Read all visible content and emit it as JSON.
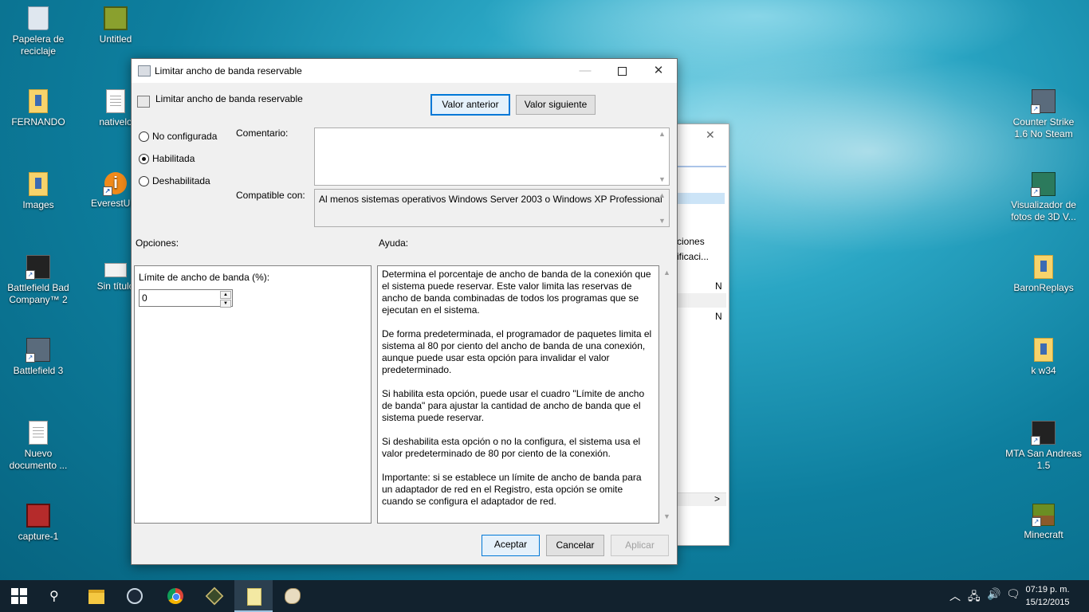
{
  "desktop": {
    "icons_left": [
      {
        "label": "Papelera de reciclaje",
        "icon": "recycle-bin-icon"
      },
      {
        "label": "Untitled",
        "icon": "video-file-icon"
      },
      {
        "label": "FERNANDO",
        "icon": "folder-icon"
      },
      {
        "label": "nativelo",
        "icon": "text-file-icon"
      },
      {
        "label": "Images",
        "icon": "folder-icon"
      },
      {
        "label": "EverestUltir",
        "icon": "everest-app-icon"
      },
      {
        "label": "Battlefield Bad Company™ 2",
        "icon": "game-icon"
      },
      {
        "label": "Sin título",
        "icon": "drive-icon"
      },
      {
        "label": "Battlefield 3",
        "icon": "game-icon"
      },
      {
        "label": "Nuevo documento ...",
        "icon": "text-file-icon"
      },
      {
        "label": "capture-1",
        "icon": "video-file-icon"
      }
    ],
    "icons_right": [
      {
        "label": "Counter Strike 1.6 No Steam",
        "icon": "counter-strike-icon"
      },
      {
        "label": "Visualizador de fotos de 3D V...",
        "icon": "photo-viewer-icon"
      },
      {
        "label": "BaronReplays",
        "icon": "folder-icon"
      },
      {
        "label": "k w34",
        "icon": "folder-icon"
      },
      {
        "label": "MTA San Andreas 1.5",
        "icon": "game-icon"
      },
      {
        "label": "Minecraft",
        "icon": "minecraft-icon"
      }
    ]
  },
  "background_window": {
    "partial_text_1": "ciones",
    "partial_text_2": "ificaci...",
    "partial_text_3": "N",
    "partial_text_4": "N",
    "scroll_right": ">"
  },
  "dialog": {
    "title": "Limitar ancho de banda reservable",
    "header_title": "Limitar ancho de banda reservable",
    "prev_button": "Valor anterior",
    "next_button": "Valor siguiente",
    "radio_options": [
      {
        "label": "No configurada",
        "selected": false
      },
      {
        "label": "Habilitada",
        "selected": true
      },
      {
        "label": "Deshabilitada",
        "selected": false
      }
    ],
    "comment_label": "Comentario:",
    "comment_value": "",
    "compatible_label": "Compatible con:",
    "compatible_value": "Al menos sistemas operativos Windows Server 2003 o Windows XP Professional",
    "options_label": "Opciones:",
    "help_label": "Ayuda:",
    "limit_label": "Límite de ancho de banda (%):",
    "limit_value": "0",
    "help_paragraphs": [
      "Determina el porcentaje de ancho de banda de la conexión que el sistema puede reservar. Este valor limita las reservas de ancho de banda combinadas de todos los programas que se ejecutan en el sistema.",
      "De forma predeterminada, el programador de paquetes limita el sistema al 80 por ciento del ancho de banda de una conexión, aunque puede usar esta opción para invalidar el valor predeterminado.",
      "Si habilita esta opción, puede usar el cuadro \"Límite de ancho de banda\" para ajustar la cantidad de ancho de banda que el sistema puede reservar.",
      "Si deshabilita esta opción o no la configura, el sistema usa el valor predeterminado de 80 por ciento de la conexión.",
      "Importante: si se establece un límite de ancho de banda para un adaptador de red en el Registro, esta opción se omite cuando se configura el adaptador de red."
    ],
    "ok_button": "Aceptar",
    "cancel_button": "Cancelar",
    "apply_button": "Aplicar"
  },
  "taskbar": {
    "items": [
      "start-icon",
      "search-icon",
      "file-explorer-icon",
      "steam-icon",
      "chrome-icon",
      "app-icon",
      "notepad-icon",
      "paint-icon"
    ],
    "clock_time": "07:19 p. m.",
    "clock_date": "15/12/2015"
  }
}
